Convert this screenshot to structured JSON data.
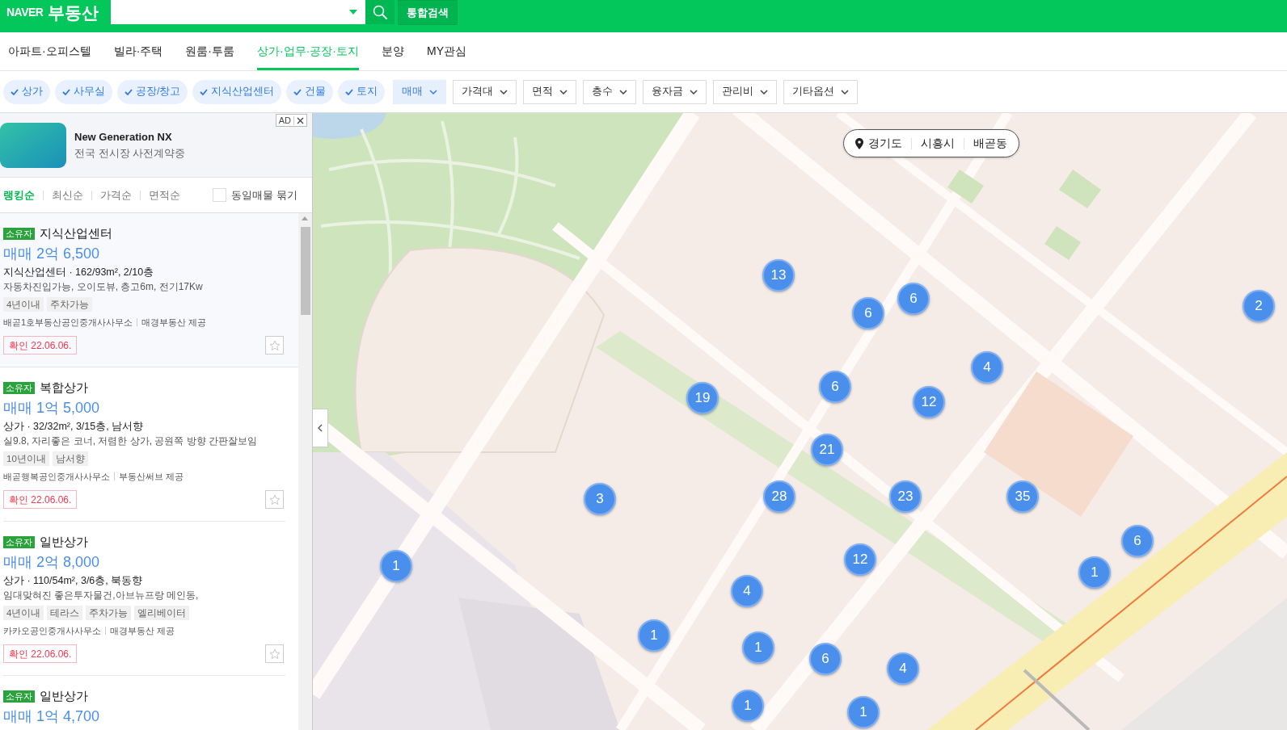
{
  "header": {
    "logo": "NAVER",
    "service": "부동산",
    "integrated_search": "통합검색"
  },
  "tabs": [
    {
      "label": "아파트·오피스텔",
      "selected": false
    },
    {
      "label": "빌라·주택",
      "selected": false
    },
    {
      "label": "원룸·투룸",
      "selected": false
    },
    {
      "label": "상가·업무·공장·토지",
      "selected": true
    },
    {
      "label": "분양",
      "selected": false
    },
    {
      "label": "MY관심",
      "selected": false
    }
  ],
  "filters": {
    "chips": [
      {
        "label": "상가",
        "checked": true
      },
      {
        "label": "사무실",
        "checked": true
      },
      {
        "label": "공장/창고",
        "checked": true
      },
      {
        "label": "지식산업센터",
        "checked": true
      },
      {
        "label": "건물",
        "checked": true
      },
      {
        "label": "토지",
        "checked": true
      }
    ],
    "dropdowns": [
      {
        "label": "매매",
        "active": true
      },
      {
        "label": "가격대",
        "active": false
      },
      {
        "label": "면적",
        "active": false
      },
      {
        "label": "층수",
        "active": false
      },
      {
        "label": "융자금",
        "active": false
      },
      {
        "label": "관리비",
        "active": false
      },
      {
        "label": "기타옵션",
        "active": false
      }
    ]
  },
  "ad": {
    "badge": "AD",
    "title": "New Generation NX",
    "subtitle": "전국 전시장 사전계약중"
  },
  "sort": {
    "options": [
      {
        "label": "랭킹순",
        "selected": true
      },
      {
        "label": "최신순",
        "selected": false
      },
      {
        "label": "가격순",
        "selected": false
      },
      {
        "label": "면적순",
        "selected": false
      }
    ],
    "group_same": {
      "label": "동일매물 묶기",
      "checked": false
    }
  },
  "listings": [
    {
      "badge": "소유자",
      "title": "지식산업센터",
      "price": "매매 2억 6,500",
      "spec": "지식산업센터 · 162/93m², 2/10층",
      "description": "자동차진입가능, 오이도뷰, 층고6m, 전기17Kw",
      "tags": [
        "4년이내",
        "주차가능"
      ],
      "agents": [
        "배곧1호부동산공인중개사사무소",
        "매경부동산 제공"
      ],
      "confirmed": "확인 22.06.06.",
      "favorite": false,
      "selected": true
    },
    {
      "badge": "소유자",
      "title": "복합상가",
      "price": "매매 1억 5,000",
      "spec": "상가 · 32/32m², 3/15층, 남서향",
      "description": "실9.8, 자리좋은 코너, 저렴한 상가, 공원쪽 방향 간판잘보임",
      "tags": [
        "10년이내",
        "남서향"
      ],
      "agents": [
        "배곧행복공인중개사사무소",
        "부동산써브 제공"
      ],
      "confirmed": "확인 22.06.06.",
      "favorite": false,
      "selected": false
    },
    {
      "badge": "소유자",
      "title": "일반상가",
      "price": "매매 2억 8,000",
      "spec": "상가 · 110/54m², 3/6층, 북동향",
      "description": "임대맞혀진 좋은투자물건,아브뉴프랑 메인동,",
      "tags": [
        "4년이내",
        "테라스",
        "주차가능",
        "엘리베이터"
      ],
      "agents": [
        "카카오공인중개사사무소",
        "매경부동산 제공"
      ],
      "confirmed": "확인 22.06.06.",
      "favorite": false,
      "selected": false
    },
    {
      "badge": "소유자",
      "title": "일반상가",
      "price": "매매 1억 4,700",
      "selected": false
    }
  ],
  "map": {
    "location": [
      "경기도",
      "시흥시",
      "배곧동"
    ],
    "clusters": [
      {
        "count": "13"
      },
      {
        "count": "6"
      },
      {
        "count": "6"
      },
      {
        "count": "4"
      },
      {
        "count": "2"
      },
      {
        "count": "19"
      },
      {
        "count": "6"
      },
      {
        "count": "12"
      },
      {
        "count": "21"
      },
      {
        "count": "3"
      },
      {
        "count": "28"
      },
      {
        "count": "23"
      },
      {
        "count": "35"
      },
      {
        "count": "6"
      },
      {
        "count": "1"
      },
      {
        "count": "12"
      },
      {
        "count": "1"
      },
      {
        "count": "4"
      },
      {
        "count": "1"
      },
      {
        "count": "1"
      },
      {
        "count": "6"
      },
      {
        "count": "4"
      },
      {
        "count": "1"
      },
      {
        "count": "1"
      }
    ]
  }
}
